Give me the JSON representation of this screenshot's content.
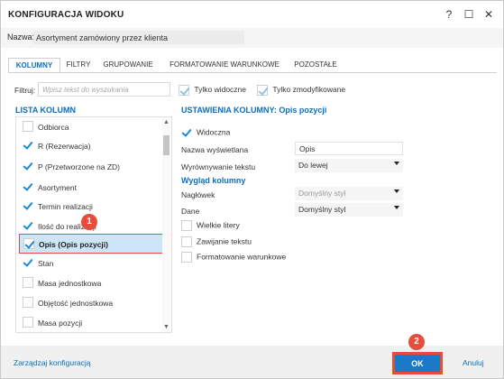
{
  "window": {
    "title": "KONFIGURACJA WIDOKU",
    "help_glyph": "?",
    "maximize_glyph": "☐",
    "close_glyph": "✕"
  },
  "name_row": {
    "label": "Nazwa:",
    "value": "Asortyment zamówiony przez klienta"
  },
  "tabs": [
    {
      "label": "KOLUMNY",
      "active": true
    },
    {
      "label": "FILTRY",
      "active": false
    },
    {
      "label": "GRUPOWANIE",
      "active": false
    },
    {
      "label": "FORMATOWANIE WARUNKOWE",
      "active": false
    },
    {
      "label": "POZOSTAŁE",
      "active": false
    }
  ],
  "filter": {
    "label": "Filtruj:",
    "placeholder": "Wpisz tekst do wyszukania",
    "only_visible_label": "Tylko widoczne",
    "only_modified_label": "Tylko zmodyfikowane"
  },
  "column_list": {
    "title": "LISTA KOLUMN",
    "items": [
      {
        "label": "Odbiorca",
        "checked": false
      },
      {
        "label": "R (Rezerwacja)",
        "checked": true
      },
      {
        "label": "P (Przetworzone na ZD)",
        "checked": true
      },
      {
        "label": "Asortyment",
        "checked": true
      },
      {
        "label": "Termin realizacji",
        "checked": true
      },
      {
        "label": "Ilość do realizacji",
        "checked": true
      },
      {
        "label": "Opis (Opis pozycji)",
        "checked": true,
        "selected": true
      },
      {
        "label": "Stan",
        "checked": true
      },
      {
        "label": "Masa jednostkowa",
        "checked": false
      },
      {
        "label": "Objętość jednostkowa",
        "checked": false
      },
      {
        "label": "Masa pozycji",
        "checked": false
      }
    ]
  },
  "settings": {
    "title": "USTAWIENIA KOLUMNY: Opis pozycji",
    "visible_label": "Widoczna",
    "display_name_label": "Nazwa wyświetlana",
    "display_name_value": "Opis",
    "alignment_label": "Wyrównywanie tekstu",
    "alignment_value": "Do lewej",
    "appearance_title": "Wygląd kolumny",
    "header_label": "Nagłówek",
    "header_value": "Domyślny styl",
    "data_label": "Dane",
    "data_value": "Domyślny styl",
    "uppercase_label": "Wielkie litery",
    "wrap_label": "Zawijanie tekstu",
    "conditional_label": "Formatowanie warunkowe"
  },
  "badges": {
    "first": "1",
    "second": "2"
  },
  "footer": {
    "manage_label": "Zarządzaj konfiguracją",
    "ok_label": "OK",
    "cancel_label": "Anuluj"
  },
  "colors": {
    "accent": "#0b6fbf",
    "primary_button": "#1a7ac7",
    "highlight": "#e74c3c",
    "selection": "#cce6f7"
  }
}
